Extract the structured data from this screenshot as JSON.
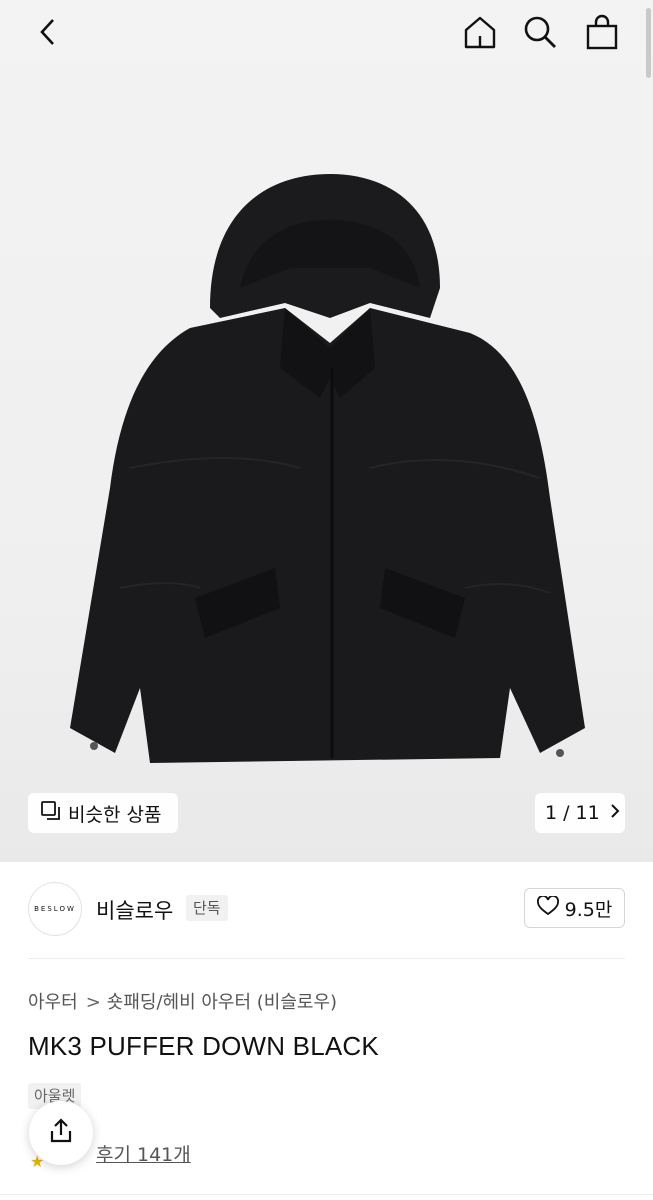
{
  "gallery": {
    "similar_label": "비슷한 상품",
    "current": "1",
    "separator": "/",
    "total": "11"
  },
  "brand": {
    "logo_text": "BESLOW",
    "name": "비슬로우",
    "badge": "단독",
    "likes": "9.5만"
  },
  "product": {
    "category_parent": "아우터",
    "category_child": "숏패딩/헤비 아우터 (비슬로우)",
    "title": "MK3 PUFFER DOWN BLACK",
    "tag": "아울렛",
    "reviews": "후기 141개"
  },
  "icons": [
    "back-icon",
    "home-icon",
    "search-icon",
    "shopping-bag-icon",
    "similar-items-icon",
    "chevron-right-icon",
    "heart-icon",
    "share-icon",
    "star-icon"
  ],
  "colors": {
    "background": "#ffffff",
    "hero_bg": "#f0f0f0",
    "jacket": "#1a1a1d",
    "star": "#e7b400"
  }
}
